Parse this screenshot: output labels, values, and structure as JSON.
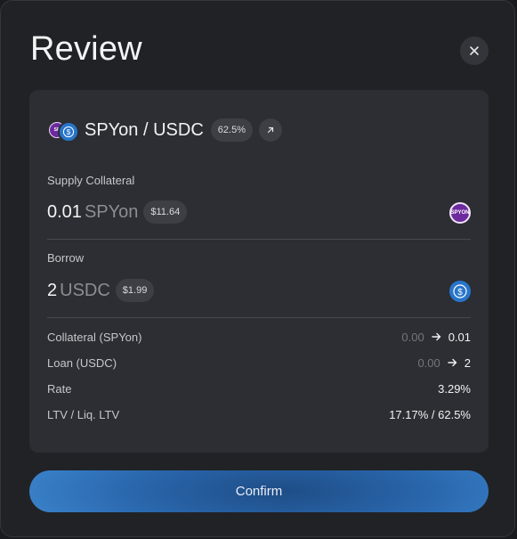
{
  "modal": {
    "title": "Review",
    "close_icon": "close-icon"
  },
  "pair": {
    "name": "SPYon / USDC",
    "lltv_badge": "62.5%",
    "icons": [
      "spyon-token-icon",
      "usdc-token-icon"
    ],
    "external_link_icon": "arrow-up-right-icon"
  },
  "supply": {
    "label": "Supply Collateral",
    "amount": "0.01",
    "unit": "SPYon",
    "usd_value": "$11.64",
    "token_icon_text": "SPYON"
  },
  "borrow": {
    "label": "Borrow",
    "amount": "2",
    "unit": "USDC",
    "usd_value": "$1.99"
  },
  "details": [
    {
      "label": "Collateral (SPYon)",
      "from": "0.00",
      "to": "0.01"
    },
    {
      "label": "Loan (USDC)",
      "from": "0.00",
      "to": "2"
    },
    {
      "label": "Rate",
      "value": "3.29%"
    },
    {
      "label": "LTV / Liq. LTV",
      "value": "17.17% / 62.5%"
    }
  ],
  "actions": {
    "confirm_label": "Confirm"
  },
  "colors": {
    "background": "#212226",
    "card": "#2c2e33",
    "accent_blue": "#2a67ad",
    "usdc_blue": "#2775ca",
    "spyon_purple": "#6d2a9e"
  }
}
